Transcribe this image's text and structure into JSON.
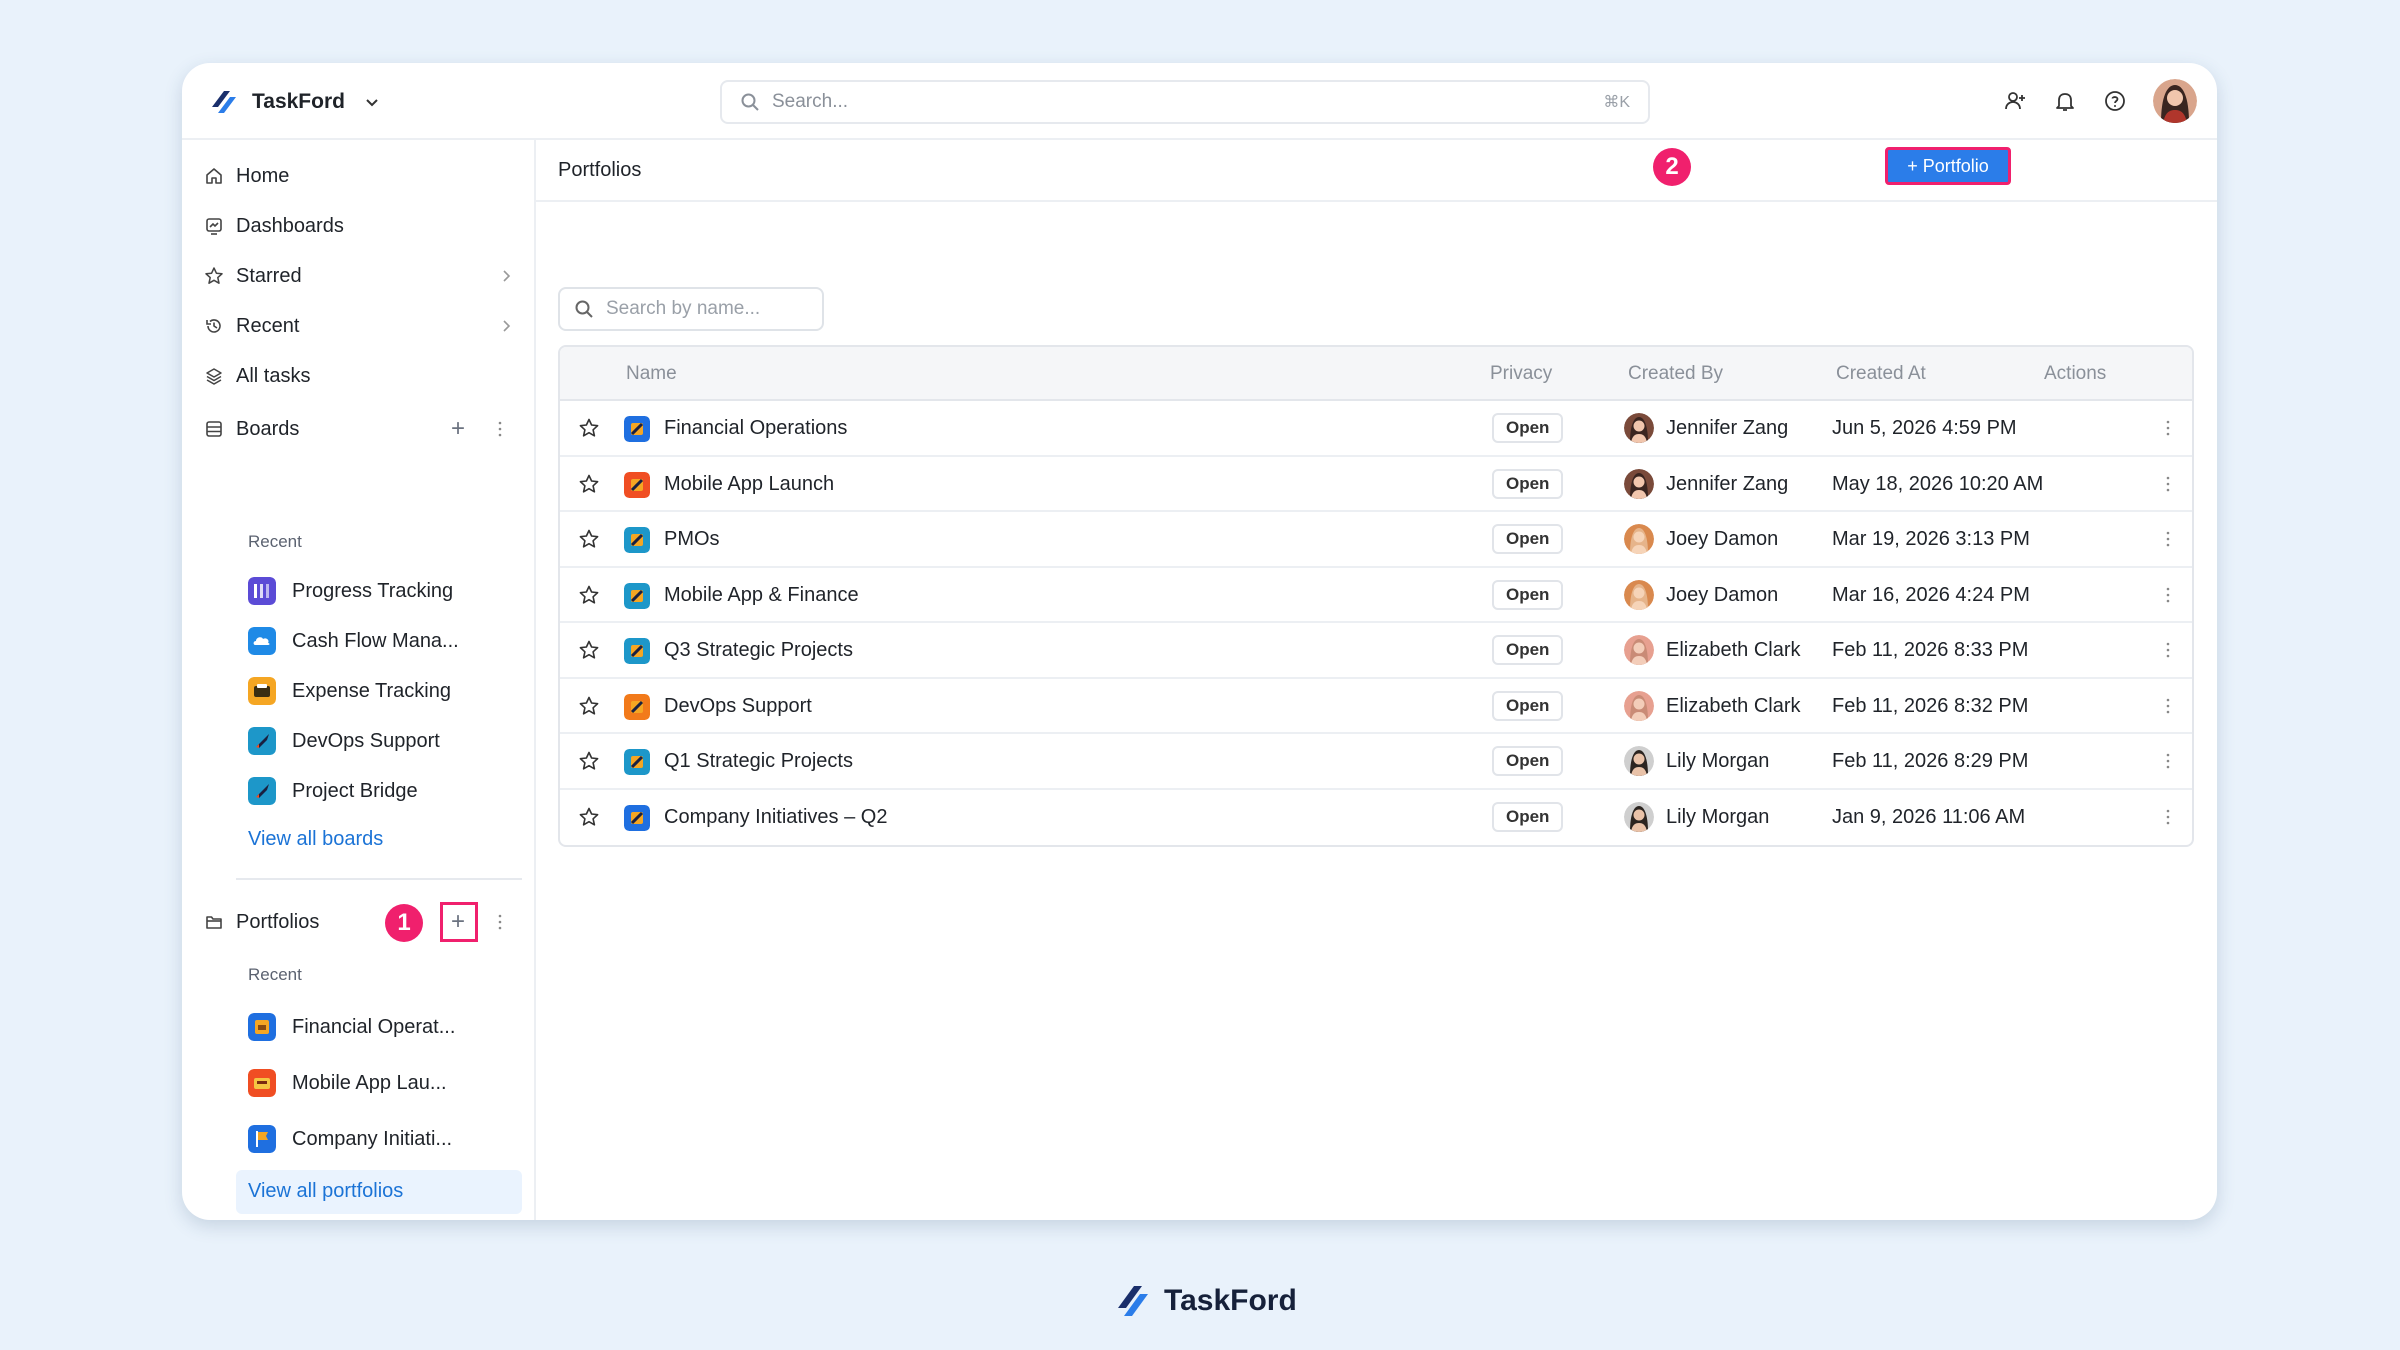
{
  "app": {
    "name": "TaskFord",
    "footer_brand": "TaskFord"
  },
  "topbar": {
    "search_placeholder": "Search...",
    "search_shortcut": "⌘K",
    "icons": [
      "invite-user-icon",
      "bell-icon",
      "help-icon"
    ]
  },
  "sidebar": {
    "nav": [
      {
        "label": "Home",
        "icon": "home-icon"
      },
      {
        "label": "Dashboards",
        "icon": "dashboard-icon"
      },
      {
        "label": "Starred",
        "icon": "star-icon"
      },
      {
        "label": "Recent",
        "icon": "history-icon"
      },
      {
        "label": "All tasks",
        "icon": "layers-icon"
      }
    ],
    "boards": {
      "label": "Boards",
      "recent_label": "Recent",
      "items": [
        {
          "label": "Progress Tracking",
          "color": "#5b4bd6"
        },
        {
          "label": "Cash Flow Mana...",
          "color": "#1f8ae6"
        },
        {
          "label": "Expense Tracking",
          "color": "#f5a623"
        },
        {
          "label": "DevOps Support",
          "color": "#1d97c9"
        },
        {
          "label": "Project Bridge",
          "color": "#1d97c9"
        }
      ],
      "view_all": "View all boards"
    },
    "portfolios": {
      "label": "Portfolios",
      "marker": "1",
      "recent_label": "Recent",
      "items": [
        {
          "label": "Financial Operat...",
          "color": "#1f6fe0"
        },
        {
          "label": "Mobile App Lau...",
          "color": "#f04e23"
        },
        {
          "label": "Company Initiati...",
          "color": "#1f6fe0"
        }
      ],
      "view_all": "View all portfolios"
    }
  },
  "main": {
    "title": "Portfolios",
    "search_placeholder": "Search by name...",
    "add_button": "+ Portfolio",
    "marker": "2",
    "columns": [
      "Name",
      "Privacy",
      "Created By",
      "Created At",
      "Actions"
    ],
    "rows": [
      {
        "name": "Financial Operations",
        "privacy": "Open",
        "created_by": "Jennifer Zang",
        "created_at": "Jun 5, 2026 4:59 PM",
        "color": "#1f6fe0"
      },
      {
        "name": "Mobile App Launch",
        "privacy": "Open",
        "created_by": "Jennifer Zang",
        "created_at": "May 18, 2026 10:20 AM",
        "color": "#f04e23"
      },
      {
        "name": "PMOs",
        "privacy": "Open",
        "created_by": "Joey Damon",
        "created_at": "Mar 19, 2026 3:13 PM",
        "color": "#1d97c9"
      },
      {
        "name": "Mobile App & Finance",
        "privacy": "Open",
        "created_by": "Joey Damon",
        "created_at": "Mar 16, 2026 4:24 PM",
        "color": "#1d97c9"
      },
      {
        "name": "Q3 Strategic Projects",
        "privacy": "Open",
        "created_by": "Elizabeth Clark",
        "created_at": "Feb 11, 2026 8:33 PM",
        "color": "#1d97c9"
      },
      {
        "name": "DevOps Support",
        "privacy": "Open",
        "created_by": "Elizabeth Clark",
        "created_at": "Feb 11, 2026 8:32 PM",
        "color": "#f27a1a"
      },
      {
        "name": "Q1 Strategic Projects",
        "privacy": "Open",
        "created_by": "Lily Morgan",
        "created_at": "Feb 11, 2026 8:29 PM",
        "color": "#1d97c9"
      },
      {
        "name": "Company Initiatives – Q2",
        "privacy": "Open",
        "created_by": "Lily Morgan",
        "created_at": "Jan 9, 2026 11:06 AM",
        "color": "#1f6fe0"
      }
    ]
  }
}
